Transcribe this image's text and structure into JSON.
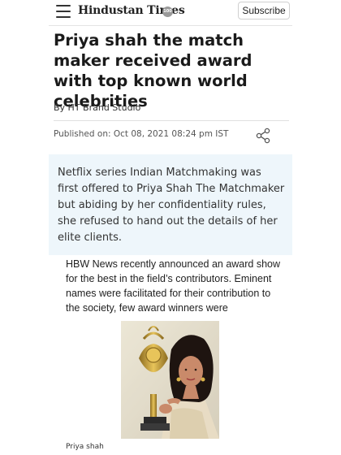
{
  "header": {
    "logo_text": "Hindustan Times",
    "logo_badge": "100",
    "subscribe_label": "Subscribe"
  },
  "article": {
    "headline": "Priya shah the match maker received award with top known world celebrities",
    "byline": "By HT Brand Studio",
    "published": "Published on: Oct 08, 2021 08:24 pm IST",
    "summary": "Netflix series Indian Matchmaking was first offered to Priya Shah The Matchmaker but abiding by her confidentiality rules, she refused to hand out the details of her elite clients.",
    "body": "HBW News recently announced an award show for the best in the field’s contributors. Eminent names were facilitated for their contribution to the society, few award winners were",
    "image_caption": "Priya shah"
  },
  "colors": {
    "summary_bg": "#eef6fb",
    "divider": "#e0e0e0",
    "trophy_gold": "#c9a13a"
  },
  "icons": [
    "menu-icon",
    "share-icon"
  ]
}
